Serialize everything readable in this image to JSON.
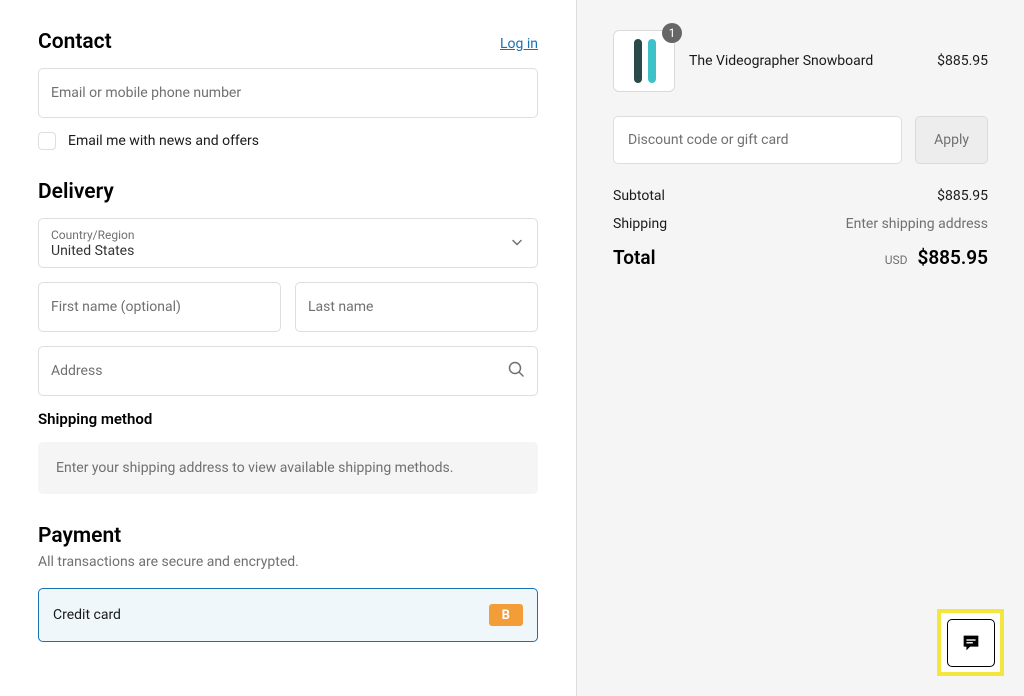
{
  "contact": {
    "heading": "Contact",
    "login_label": "Log in",
    "email_placeholder": "Email or mobile phone number",
    "news_offers_label": "Email me with news and offers"
  },
  "delivery": {
    "heading": "Delivery",
    "country_label": "Country/Region",
    "country_value": "United States",
    "first_name_placeholder": "First name (optional)",
    "last_name_placeholder": "Last name",
    "address_placeholder": "Address",
    "shipping_method_heading": "Shipping method",
    "shipping_method_placeholder": "Enter your shipping address to view available shipping methods."
  },
  "payment": {
    "heading": "Payment",
    "subtext": "All transactions are secure and encrypted.",
    "credit_card_label": "Credit card",
    "badge_letter": "B"
  },
  "cart": {
    "item": {
      "name": "The Videographer Snowboard",
      "price": "$885.95",
      "qty": "1"
    },
    "discount_placeholder": "Discount code or gift card",
    "apply_label": "Apply",
    "subtotal_label": "Subtotal",
    "subtotal_value": "$885.95",
    "shipping_label": "Shipping",
    "shipping_value": "Enter shipping address",
    "total_label": "Total",
    "currency": "USD",
    "total_value": "$885.95"
  }
}
